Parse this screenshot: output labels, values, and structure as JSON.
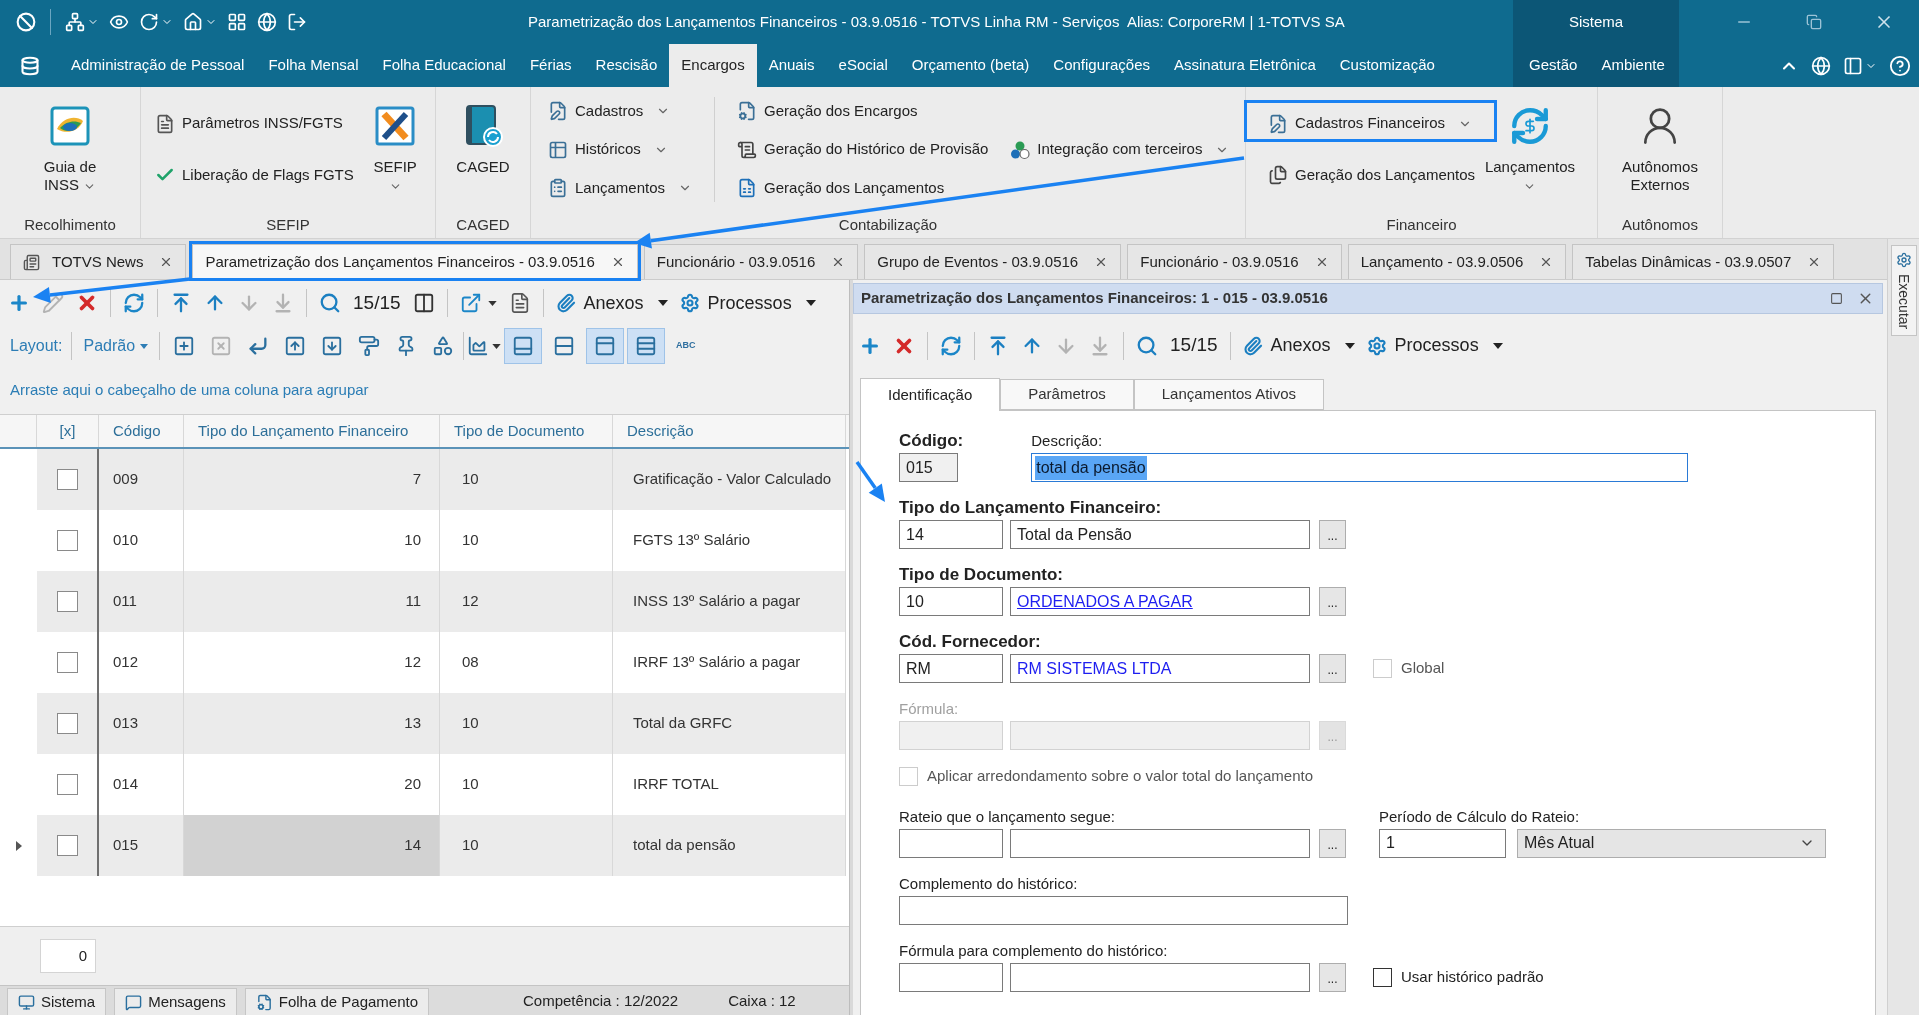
{
  "title_bar": {
    "title": "Parametrização dos Lançamentos Financeiros - 03.9.0516 - TOTVS Linha RM - Serviços  Alias: CorporeRM | 1-TOTVS SA",
    "context_title": "Sistema"
  },
  "menu": [
    {
      "label": "Administração de Pessoal",
      "kind": "main",
      "selected": false
    },
    {
      "label": "Folha Mensal",
      "kind": "main",
      "selected": false
    },
    {
      "label": "Folha Educacional",
      "kind": "main",
      "selected": false
    },
    {
      "label": "Férias",
      "kind": "main",
      "selected": false
    },
    {
      "label": "Rescisão",
      "kind": "main",
      "selected": false
    },
    {
      "label": "Encargos",
      "kind": "main",
      "selected": true
    },
    {
      "label": "Anuais",
      "kind": "main",
      "selected": false
    },
    {
      "label": "eSocial",
      "kind": "main",
      "selected": false
    },
    {
      "label": "Orçamento (beta)",
      "kind": "main",
      "selected": false
    },
    {
      "label": "Configurações",
      "kind": "main",
      "selected": false
    },
    {
      "label": "Assinatura Eletrônica",
      "kind": "main",
      "selected": false
    },
    {
      "label": "Customização",
      "kind": "main",
      "selected": false
    },
    {
      "label": "Gestão",
      "kind": "context",
      "selected": false
    },
    {
      "label": "Ambiente",
      "kind": "context",
      "selected": false
    }
  ],
  "ribbon": [
    {
      "label": "Recolhimento",
      "columns": [
        [
          {
            "kind": "large",
            "label": "Guia de INSS",
            "dropdown": true,
            "highlighted": false
          }
        ]
      ]
    },
    {
      "label": "SEFIP",
      "columns": [
        [
          {
            "kind": "small",
            "label": "Parâmetros INSS/FGTS",
            "dropdown": false,
            "highlighted": false
          },
          {
            "kind": "small",
            "label": "Liberação de Flags FGTS",
            "dropdown": false,
            "highlighted": false
          }
        ],
        [
          {
            "kind": "large",
            "label": "SEFIP",
            "dropdown": true,
            "highlighted": false
          }
        ]
      ]
    },
    {
      "label": "CAGED",
      "columns": [
        [
          {
            "kind": "large",
            "label": "CAGED",
            "dropdown": false,
            "highlighted": false
          }
        ]
      ]
    },
    {
      "label": "Contabilização",
      "columns": [
        [
          {
            "kind": "small",
            "label": "Cadastros",
            "dropdown": true,
            "highlighted": false
          },
          {
            "kind": "small",
            "label": "Históricos",
            "dropdown": true,
            "highlighted": false
          },
          {
            "kind": "small",
            "label": "Lançamentos",
            "dropdown": true,
            "highlighted": false
          }
        ],
        [
          {
            "kind": "small",
            "label": "Geração dos Encargos",
            "dropdown": false,
            "highlighted": false
          },
          {
            "kind": "small",
            "label": "Geração do Histórico de Provisão",
            "dropdown": false,
            "highlighted": false
          },
          {
            "kind": "small",
            "label": "Geração dos Lançamentos",
            "dropdown": false,
            "highlighted": false
          }
        ],
        [
          {
            "kind": "small",
            "label": "Integração com terceiros",
            "dropdown": true,
            "highlighted": false
          }
        ]
      ]
    },
    {
      "label": "Financeiro",
      "columns": [
        [
          {
            "kind": "small",
            "label": "Cadastros Financeiros",
            "dropdown": true,
            "highlighted": true
          },
          {
            "kind": "small",
            "label": "Geração dos Lançamentos",
            "dropdown": false,
            "highlighted": false
          }
        ],
        [
          {
            "kind": "large",
            "label": "Lançamentos",
            "dropdown": true,
            "highlighted": false
          }
        ]
      ]
    },
    {
      "label": "Autônomos",
      "columns": [
        [
          {
            "kind": "large",
            "label": "Autônomos Externos",
            "dropdown": false,
            "highlighted": false
          }
        ]
      ]
    }
  ],
  "document_tabs": [
    {
      "label": "TOTVS News",
      "selected": false,
      "highlighted": false
    },
    {
      "label": "Parametrização dos Lançamentos Financeiros - 03.9.0516",
      "selected": true,
      "highlighted": true
    },
    {
      "label": "Funcionário - 03.9.0516",
      "selected": false,
      "highlighted": false
    },
    {
      "label": "Grupo de Eventos - 03.9.0516",
      "selected": false,
      "highlighted": false
    },
    {
      "label": "Funcionário - 03.9.0516",
      "selected": false,
      "highlighted": false
    },
    {
      "label": "Lançamento - 03.9.0506",
      "selected": false,
      "highlighted": false
    },
    {
      "label": "Tabelas Dinâmicas - 03.9.0507",
      "selected": false,
      "highlighted": false
    }
  ],
  "list_view": {
    "toolbar": [
      {
        "kind": "add",
        "disabled": false
      },
      {
        "kind": "edit",
        "disabled": true
      },
      {
        "kind": "delete",
        "disabled": false
      },
      {
        "kind": "separator"
      },
      {
        "kind": "refresh",
        "disabled": false
      },
      {
        "kind": "separator"
      },
      {
        "kind": "first",
        "disabled": false
      },
      {
        "kind": "previous",
        "disabled": false
      },
      {
        "kind": "next",
        "disabled": true
      },
      {
        "kind": "last",
        "disabled": true
      },
      {
        "kind": "separator"
      },
      {
        "kind": "search",
        "disabled": false
      },
      {
        "kind": "counter",
        "label": "15/15"
      },
      {
        "kind": "columns",
        "disabled": false
      },
      {
        "kind": "separator"
      },
      {
        "kind": "export",
        "disabled": false,
        "dropdown": true
      },
      {
        "kind": "report",
        "disabled": false
      },
      {
        "kind": "separator"
      },
      {
        "kind": "attachments",
        "label": "Anexos",
        "dropdown": true
      },
      {
        "kind": "processes",
        "label": "Processos",
        "dropdown": true
      }
    ],
    "layout_bar": {
      "label": "Layout:",
      "value": "Padrão",
      "tools": [
        {
          "kind": "insert_row",
          "disabled": false
        },
        {
          "kind": "delete_row",
          "disabled": true
        },
        {
          "kind": "enter",
          "disabled": false
        },
        {
          "kind": "move_up",
          "disabled": false
        },
        {
          "kind": "move_down",
          "disabled": false
        },
        {
          "kind": "paint",
          "disabled": false
        },
        {
          "kind": "pin",
          "disabled": false
        },
        {
          "kind": "shapes",
          "disabled": false
        },
        {
          "kind": "separator"
        },
        {
          "kind": "chart",
          "disabled": false,
          "dropdown": true
        },
        {
          "kind": "view_bottom",
          "pressed": true
        },
        {
          "kind": "view_split",
          "pressed": false
        },
        {
          "kind": "view_top",
          "pressed": true
        },
        {
          "kind": "view_rows",
          "pressed": true
        },
        {
          "kind": "spelling",
          "label": "ABC"
        }
      ]
    },
    "grid": {
      "group_hint": "Arraste aqui o cabeçalho de uma coluna para agrupar",
      "check_column": "[x]",
      "columns": [
        {
          "label": "Código",
          "current": false
        },
        {
          "label": "Tipo do Lançamento Financeiro",
          "current": true
        },
        {
          "label": "Tipo de Documento",
          "current": false
        },
        {
          "label": "Descrição",
          "current": false
        }
      ],
      "rows": [
        {
          "checked": false,
          "selected": false,
          "cells": [
            "009",
            "7",
            "10",
            "Gratificação - Valor Calculado"
          ]
        },
        {
          "checked": false,
          "selected": false,
          "cells": [
            "010",
            "10",
            "10",
            "FGTS 13º Salário"
          ]
        },
        {
          "checked": false,
          "selected": false,
          "cells": [
            "011",
            "11",
            "12",
            "INSS 13º Salário a pagar"
          ]
        },
        {
          "checked": false,
          "selected": false,
          "cells": [
            "012",
            "12",
            "08",
            "IRRF 13º Salário a pagar"
          ]
        },
        {
          "checked": false,
          "selected": false,
          "cells": [
            "013",
            "13",
            "10",
            "Total da GRFC"
          ]
        },
        {
          "checked": false,
          "selected": false,
          "cells": [
            "014",
            "20",
            "10",
            "IRRF TOTAL"
          ]
        },
        {
          "checked": false,
          "selected": true,
          "cells": [
            "015",
            "14",
            "10",
            "total da pensão"
          ]
        }
      ],
      "footer_value": "0"
    },
    "status_bar": {
      "tabs": [
        {
          "label": "Sistema"
        },
        {
          "label": "Mensagens"
        },
        {
          "label": "Folha de Pagamento"
        }
      ],
      "info": [
        "Competência : 12/2022",
        "Caixa : 12"
      ]
    }
  },
  "detail": {
    "title": "Parametrização dos Lançamentos Financeiros: 1 - 015 - 03.9.0516",
    "toolbar": [
      {
        "kind": "add",
        "disabled": false
      },
      {
        "kind": "delete",
        "disabled": false
      },
      {
        "kind": "separator"
      },
      {
        "kind": "refresh",
        "disabled": false
      },
      {
        "kind": "separator"
      },
      {
        "kind": "first",
        "disabled": false
      },
      {
        "kind": "previous",
        "disabled": false
      },
      {
        "kind": "next",
        "disabled": true
      },
      {
        "kind": "last",
        "disabled": true
      },
      {
        "kind": "separator"
      },
      {
        "kind": "search",
        "disabled": false
      },
      {
        "kind": "counter",
        "label": "15/15"
      },
      {
        "kind": "separator"
      },
      {
        "kind": "attachments",
        "label": "Anexos",
        "dropdown": true
      },
      {
        "kind": "processes",
        "label": "Processos",
        "dropdown": true
      }
    ],
    "tabs": [
      {
        "label": "Identificação",
        "selected": true
      },
      {
        "label": "Parâmetros",
        "selected": false
      },
      {
        "label": "Lançamentos Ativos",
        "selected": false
      }
    ],
    "form": [
      {
        "kind": "header",
        "code": {
          "label": "Código:",
          "value": "015",
          "readonly": true
        },
        "description": {
          "label": "Descrição:",
          "value": "total da pensão",
          "focused": true
        }
      },
      {
        "kind": "lookup",
        "label": "Tipo do Lançamento Financeiro:",
        "required": true,
        "disabled": false,
        "code": "14",
        "name": {
          "value": "Total da Pensão",
          "color": "#222222",
          "link": false
        },
        "button": "..."
      },
      {
        "kind": "lookup",
        "label": "Tipo de Documento:",
        "required": true,
        "disabled": false,
        "code": "10",
        "name": {
          "value": "ORDENADOS A PAGAR",
          "color": "#1e1ef0",
          "link": true
        },
        "button": "..."
      },
      {
        "kind": "lookup",
        "label": "Cód. Fornecedor:",
        "required": true,
        "disabled": false,
        "code": "RM",
        "name": {
          "value": "RM SISTEMAS LTDA",
          "color": "#1e1ef0",
          "link": false
        },
        "button": "...",
        "checkbox": {
          "label": "Global",
          "checked": false,
          "disabled": true
        }
      },
      {
        "kind": "lookup",
        "label": "Fórmula:",
        "required": false,
        "disabled": true,
        "button": "..."
      },
      {
        "kind": "checkbox",
        "label": "Aplicar arredondamento sobre o valor total do lançamento",
        "checked": false,
        "disabled": true
      },
      {
        "kind": "lookup",
        "label": "Rateio que o lançamento segue:",
        "required": false,
        "disabled": false,
        "button": "...",
        "period": {
          "label": "Período de Cálculo do Rateio:",
          "value": "1",
          "option": "Mês Atual"
        }
      },
      {
        "kind": "text",
        "label": "Complemento do histórico:"
      },
      {
        "kind": "lookup",
        "label": "Fórmula para complemento do histórico:",
        "required": false,
        "disabled": false,
        "button": "...",
        "checkbox": {
          "label": "Usar histórico padrão",
          "checked": false,
          "disabled": false
        }
      }
    ]
  },
  "side_panel": {
    "label": "Executar"
  }
}
